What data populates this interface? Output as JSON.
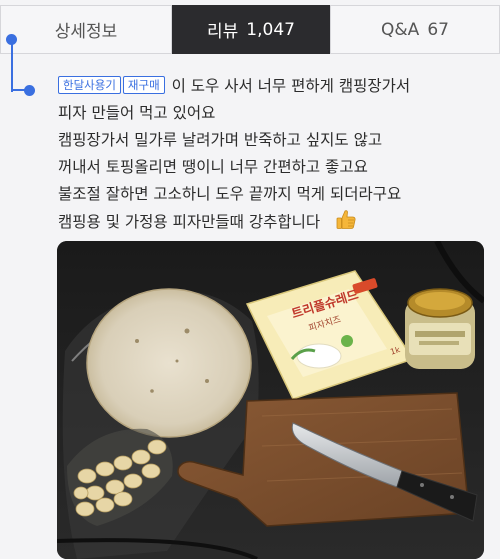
{
  "tabs": [
    {
      "label": "상세정보",
      "count": ""
    },
    {
      "label": "리뷰",
      "count": "1,047"
    },
    {
      "label": "Q&A",
      "count": "67"
    }
  ],
  "review": {
    "badges": [
      "한달사용기",
      "재구매"
    ],
    "lines": [
      "이 도우 사서 너무 편하게 캠핑장가서",
      "피자 만들어 먹고 있어요",
      "캠핑장가서 밀가루 날려가며 반죽하고 싶지도 않고",
      "꺼내서 토핑올리면 땡이니 너무 간편하고 좋고요",
      "불조절 잘하면 고소하니 도우 끝까지 먹게 되더라구요",
      "캠핑용 및 가정용 피자만들때 강추합니다"
    ]
  },
  "photo": {
    "cheese_brand": "트리플슈레드",
    "cheese_sub": "피자치즈",
    "cheese_size": "1k"
  },
  "colors": {
    "accent": "#3a6fe0",
    "active_tab": "#2b2b2e"
  }
}
